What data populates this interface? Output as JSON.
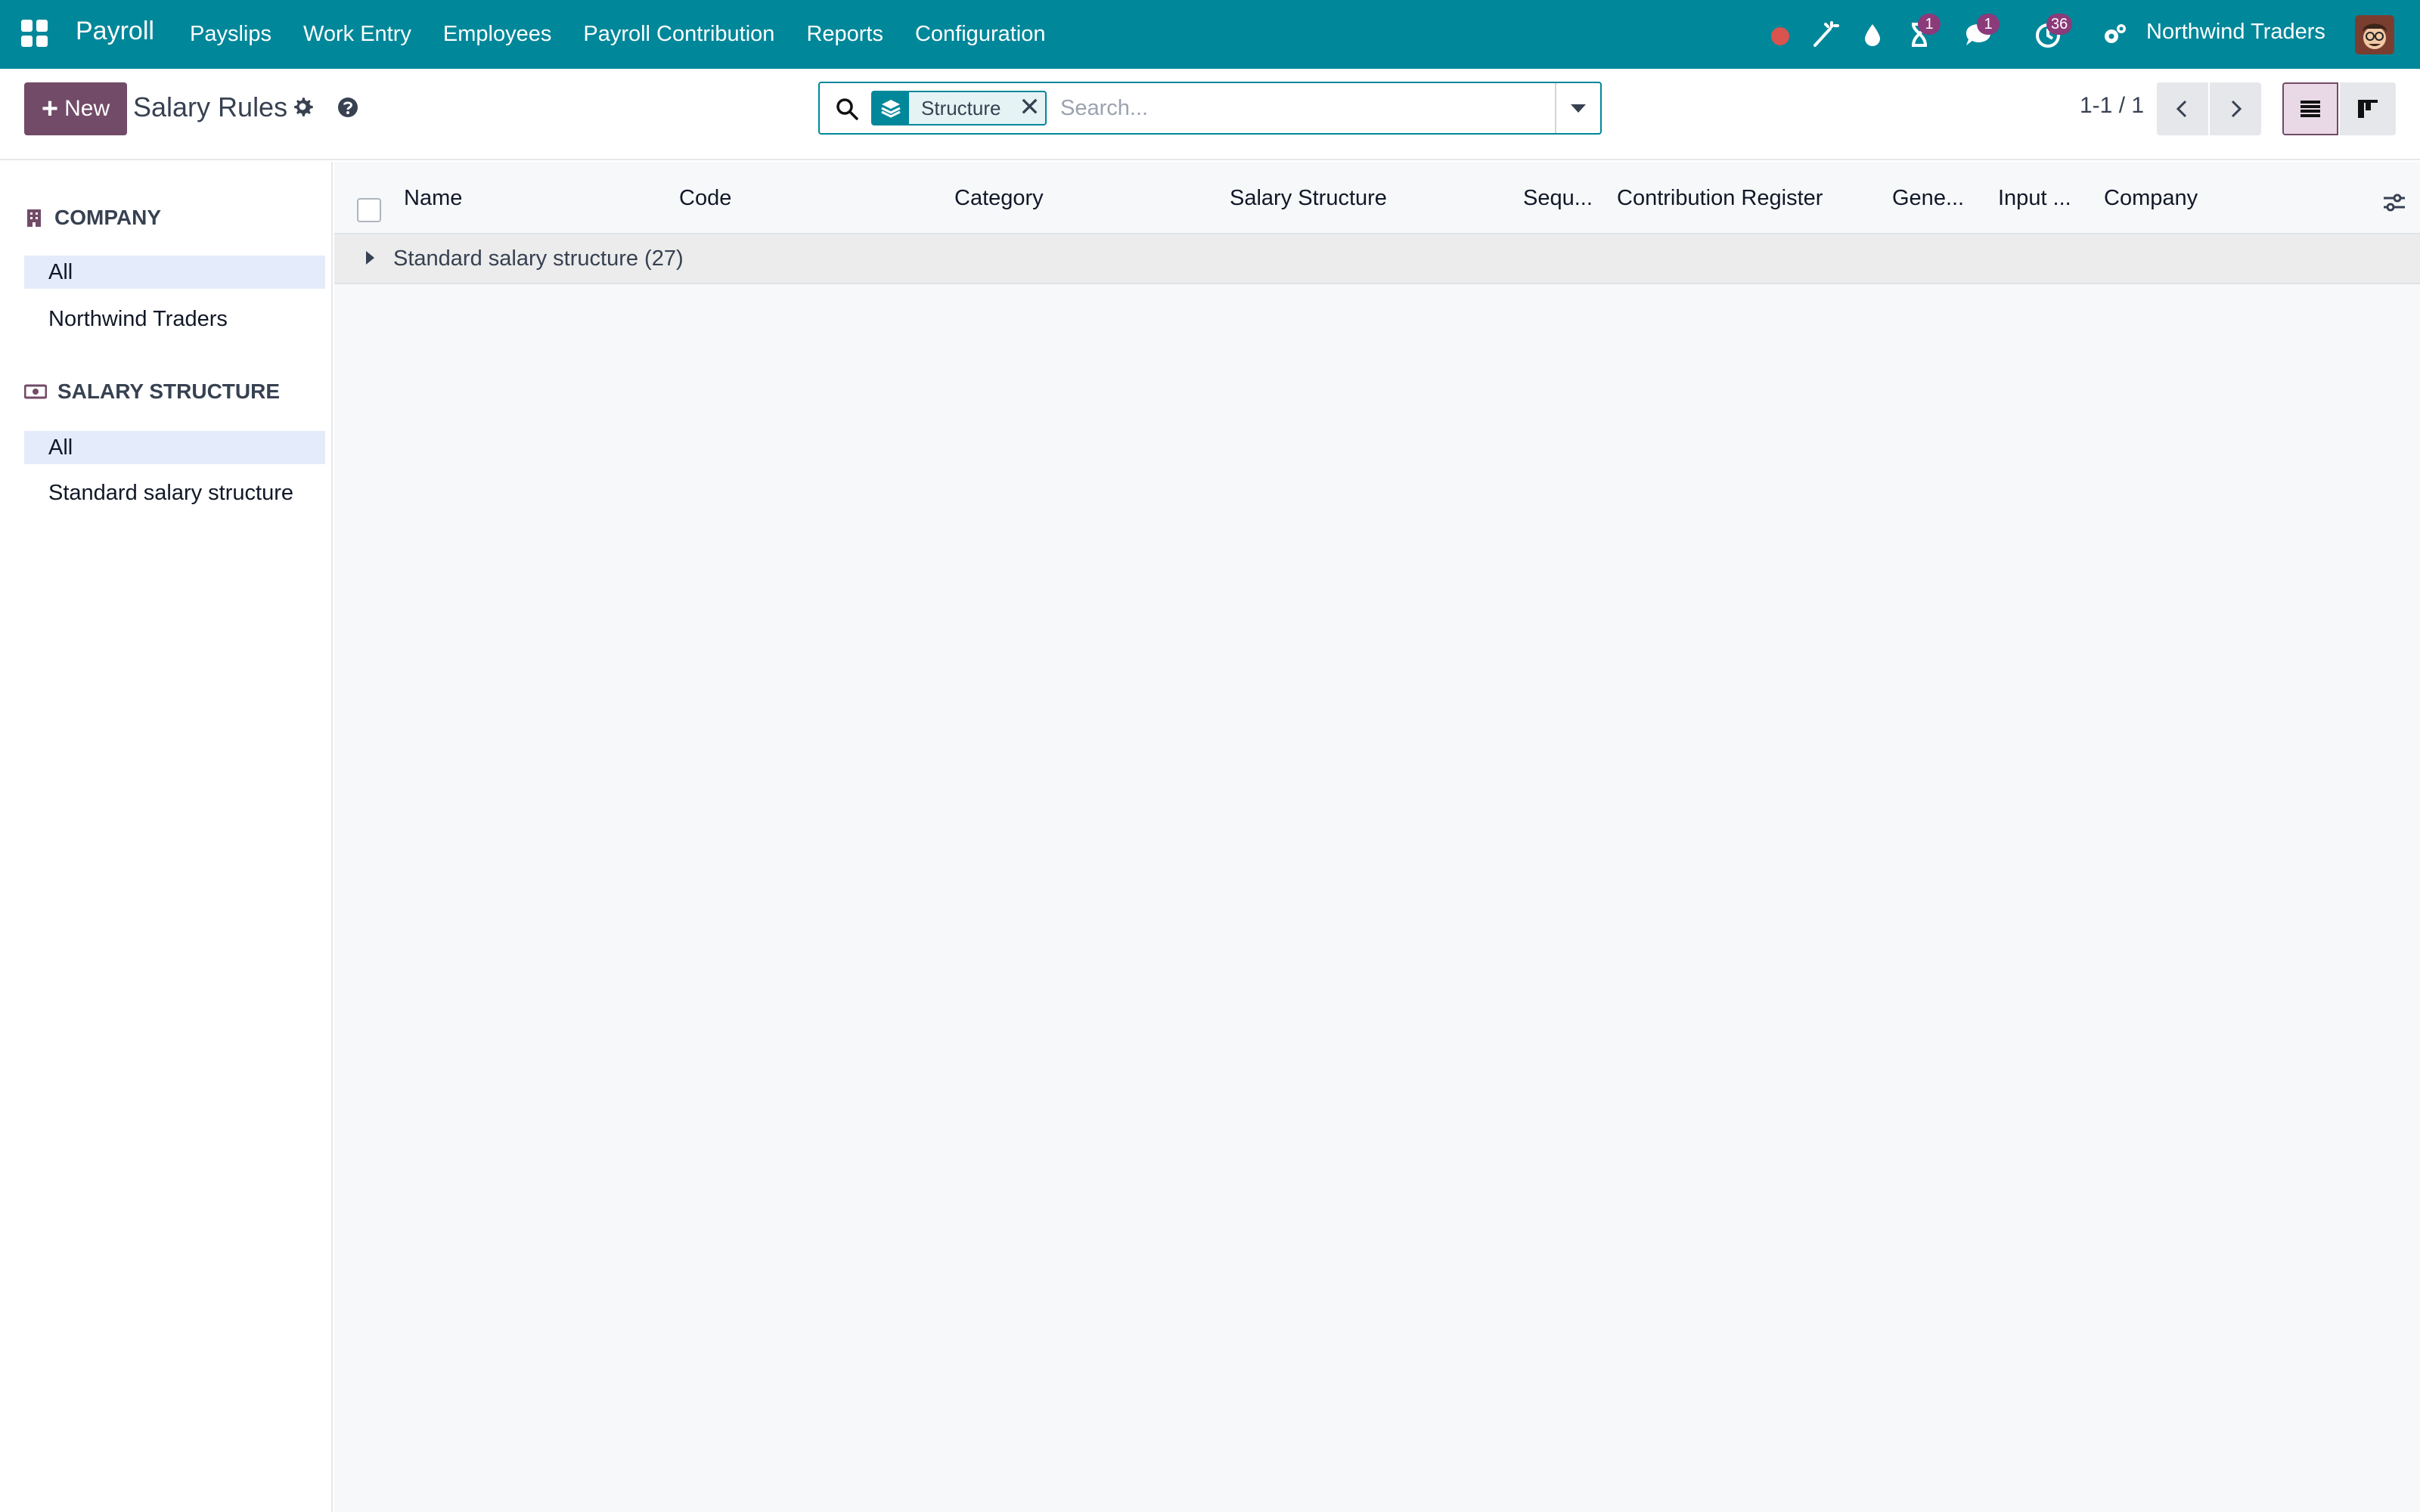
{
  "navbar": {
    "app_name": "Payroll",
    "menu": [
      "Payslips",
      "Work Entry",
      "Employees",
      "Payroll Contribution",
      "Reports",
      "Configuration"
    ],
    "badges": {
      "activity": "1",
      "messages": "1",
      "clock": "36"
    },
    "company": "Northwind Traders",
    "colors": {
      "navbar": "#00879a",
      "badge": "#8b3a7a",
      "record_dot": "#d9534f"
    }
  },
  "control": {
    "new_label": "New",
    "title": "Salary Rules",
    "facet_label": "Structure",
    "search_placeholder": "Search...",
    "pager": "1-1 / 1",
    "colors": {
      "primary": "#714b67"
    }
  },
  "sidebar": {
    "company_header": "COMPANY",
    "company_items": [
      "All",
      "Northwind Traders"
    ],
    "structure_header": "SALARY STRUCTURE",
    "structure_items": [
      "All",
      "Standard salary structure"
    ]
  },
  "table": {
    "columns": [
      "Name",
      "Code",
      "Category",
      "Salary Structure",
      "Sequ...",
      "Contribution Register",
      "Gene...",
      "Input ...",
      "Company"
    ],
    "groups": [
      {
        "label": "Standard salary structure (27)"
      }
    ]
  }
}
